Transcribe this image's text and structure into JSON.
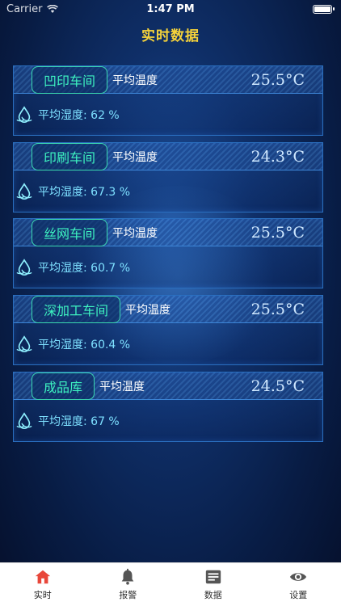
{
  "status_bar": {
    "carrier": "Carrier",
    "time": "1:47 PM"
  },
  "nav": {
    "title": "实时数据"
  },
  "cards": [
    {
      "name": "凹印车间",
      "temp_label": "平均温度",
      "temp_value": "25.5°C",
      "humidity_text": "平均湿度: 62 %"
    },
    {
      "name": "印刷车间",
      "temp_label": "平均温度",
      "temp_value": "24.3°C",
      "humidity_text": "平均湿度: 67.3 %"
    },
    {
      "name": "丝网车间",
      "temp_label": "平均温度",
      "temp_value": "25.5°C",
      "humidity_text": "平均湿度: 60.7 %"
    },
    {
      "name": "深加工车间",
      "temp_label": "平均温度",
      "temp_value": "25.5°C",
      "humidity_text": "平均湿度: 60.4 %"
    },
    {
      "name": "成品库",
      "temp_label": "平均温度",
      "temp_value": "24.5°C",
      "humidity_text": "平均湿度: 67 %"
    }
  ],
  "tabs": [
    {
      "label": "实时",
      "icon": "home-icon",
      "active": true
    },
    {
      "label": "报警",
      "icon": "bell-icon",
      "active": false
    },
    {
      "label": "数据",
      "icon": "data-icon",
      "active": false
    },
    {
      "label": "设置",
      "icon": "eye-icon",
      "active": false
    }
  ],
  "colors": {
    "title": "#f5d23a",
    "workshop_name": "#3df2c0",
    "humidity": "#7ee0ff",
    "active_tab": "#e8473a"
  }
}
